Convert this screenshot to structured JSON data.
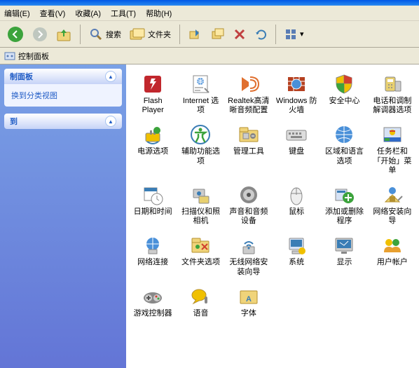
{
  "menu": [
    "编辑(E)",
    "查看(V)",
    "收藏(A)",
    "工具(T)",
    "帮助(H)"
  ],
  "toolbar": {
    "search": "搜索",
    "folders": "文件夹"
  },
  "address": {
    "label": "控制面板"
  },
  "sidebar": {
    "panel1": {
      "title": "制面板",
      "link": "换到分类视图"
    },
    "panel2": {
      "title": "到"
    }
  },
  "items": [
    {
      "label": "Flash Player",
      "icon": "flash"
    },
    {
      "label": "Internet 选项",
      "icon": "inet"
    },
    {
      "label": "Realtek高清晰音频配置",
      "icon": "realtek"
    },
    {
      "label": "Windows 防火墙",
      "icon": "firewall"
    },
    {
      "label": "安全中心",
      "icon": "shield"
    },
    {
      "label": "电话和调制解调器选项",
      "icon": "phone"
    },
    {
      "label": "电源选项",
      "icon": "power"
    },
    {
      "label": "辅助功能选项",
      "icon": "access"
    },
    {
      "label": "管理工具",
      "icon": "admin"
    },
    {
      "label": "键盘",
      "icon": "keyboard"
    },
    {
      "label": "区域和语言选项",
      "icon": "region"
    },
    {
      "label": "任务栏和「开始」菜单",
      "icon": "taskbar"
    },
    {
      "label": "日期和时间",
      "icon": "datetime"
    },
    {
      "label": "扫描仪和照相机",
      "icon": "scanner"
    },
    {
      "label": "声音和音频设备",
      "icon": "sound"
    },
    {
      "label": "鼠标",
      "icon": "mouse"
    },
    {
      "label": "添加或删除程序",
      "icon": "addremove"
    },
    {
      "label": "网络安装向导",
      "icon": "netsetup"
    },
    {
      "label": "网络连接",
      "icon": "netconn"
    },
    {
      "label": "文件夹选项",
      "icon": "folderopt"
    },
    {
      "label": "无线网络安装向导",
      "icon": "wireless"
    },
    {
      "label": "系统",
      "icon": "system"
    },
    {
      "label": "显示",
      "icon": "display"
    },
    {
      "label": "用户帐户",
      "icon": "users"
    },
    {
      "label": "游戏控制器",
      "icon": "game"
    },
    {
      "label": "语音",
      "icon": "speech"
    },
    {
      "label": "字体",
      "icon": "fonts"
    }
  ]
}
